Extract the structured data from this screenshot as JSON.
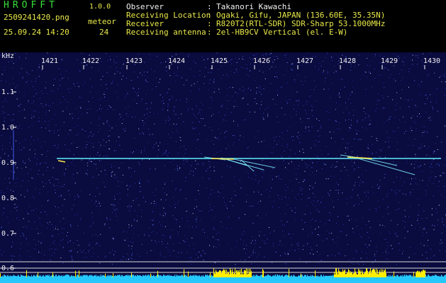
{
  "app": {
    "name": "HROFFT",
    "version": "1.0.0",
    "filename": "2509241420.png",
    "timestamp": "25.09.24 14:20",
    "meteor_label": "meteor",
    "meteor_count": "24"
  },
  "info": [
    {
      "label": "Observer",
      "value": "Takanori Kawachi"
    },
    {
      "label": "Receiving Location",
      "value": "Ogaki, Gifu, JAPAN (136.60E, 35.35N)"
    },
    {
      "label": "Receiver",
      "value": "R820T2(RTL-SDR) SDR-Sharp 53.1000MHz"
    },
    {
      "label": "Receiving antenna",
      "value": "2el-HB9CV Vertical (el. E-W)"
    }
  ],
  "separator": ":",
  "spectrogram": {
    "y_unit": "kHz",
    "x_ticks": [
      "1421",
      "1422",
      "1423",
      "1424",
      "1425",
      "1426",
      "1427",
      "1428",
      "1429",
      "1430"
    ],
    "y_ticks": [
      "1.1",
      "1.0",
      "0.9",
      "0.8",
      "0.7",
      "0.6"
    ],
    "colors": {
      "background": "#0a0b3e",
      "carrier": "#5ff0ff",
      "echo": "#ffe84a",
      "level_bar": "#24c8ff",
      "level_peak": "#ffee00",
      "ref_lines": "#d8d8d8",
      "tick_text": "#f0f0f0"
    }
  }
}
